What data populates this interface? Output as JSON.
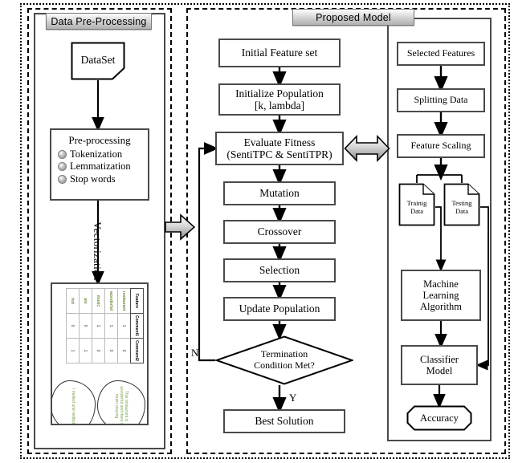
{
  "figure": {
    "type": "flowchart",
    "panels": [
      {
        "id": "left",
        "title": "Data Pre-Processing"
      },
      {
        "id": "right",
        "title": "Proposed Model"
      }
    ]
  },
  "left_panel": {
    "title": "Data Pre-Processing",
    "dataset_label": "DataSet",
    "preprocessing": {
      "title": "Pre-processing",
      "items": [
        "Tokenization",
        "Lemmatization",
        "Stop words"
      ]
    },
    "vectorization_label": "Vectorization",
    "vector_illustration": {
      "headers": [
        "Feature",
        "Comment1",
        "Comment2"
      ],
      "rows": [
        [
          "restaurant",
          "1",
          "0"
        ],
        [
          "wonderful",
          "1",
          "0"
        ],
        [
          "music",
          "1",
          "0"
        ],
        [
          "pie",
          "0",
          "1"
        ],
        [
          "hot",
          "0",
          "1"
        ]
      ],
      "bubbles": [
        "This restaurant is wonderful and there is music playing",
        "I melted and melted"
      ]
    }
  },
  "middle_panel": {
    "title": "Proposed Model",
    "nodes": {
      "initial_feature_set": "Initial Feature set",
      "initialize_population": "Initialize Population\n[k, lambda]",
      "initialize_population_line1": "Initialize Population",
      "initialize_population_line2": "[k, lambda]",
      "evaluate_fitness_line1": "Evaluate Fitness",
      "evaluate_fitness_line2": "(SentiTPC & SentiTPR)",
      "mutation": "Mutation",
      "crossover": "Crossover",
      "selection": "Selection",
      "update_population": "Update Population",
      "termination_line1": "Termination",
      "termination_line2": "Condition Met?",
      "best_solution": "Best Solution"
    },
    "branch_labels": {
      "no": "N",
      "yes": "Y"
    }
  },
  "right_panel": {
    "nodes": {
      "selected_features": "Selected Features",
      "splitting_data": "Splitting Data",
      "feature_scaling": "Feature Scaling",
      "training_data_line1": "Trainig",
      "training_data_line2": "Data",
      "testing_data_line1": "Testing",
      "testing_data_line2": "Data",
      "ml_algorithm_line1": "Machine",
      "ml_algorithm_line2": "Learning",
      "ml_algorithm_line3": "Algorithm",
      "classifier_model_line1": "Classifier",
      "classifier_model_line2": "Model",
      "accuracy": "Accuracy"
    }
  },
  "connectors": {
    "vectorization_arrow": "block-arrow-right",
    "bidirectional_arrow": "block-arrow-left-right"
  },
  "colors": {
    "stroke": "#4a4a4a",
    "text": "#000000",
    "title_bar_gradient_top": "#fdfdfd",
    "title_bar_gradient_bottom": "#b0b0b0",
    "feature_text": "#6b8e3d"
  }
}
